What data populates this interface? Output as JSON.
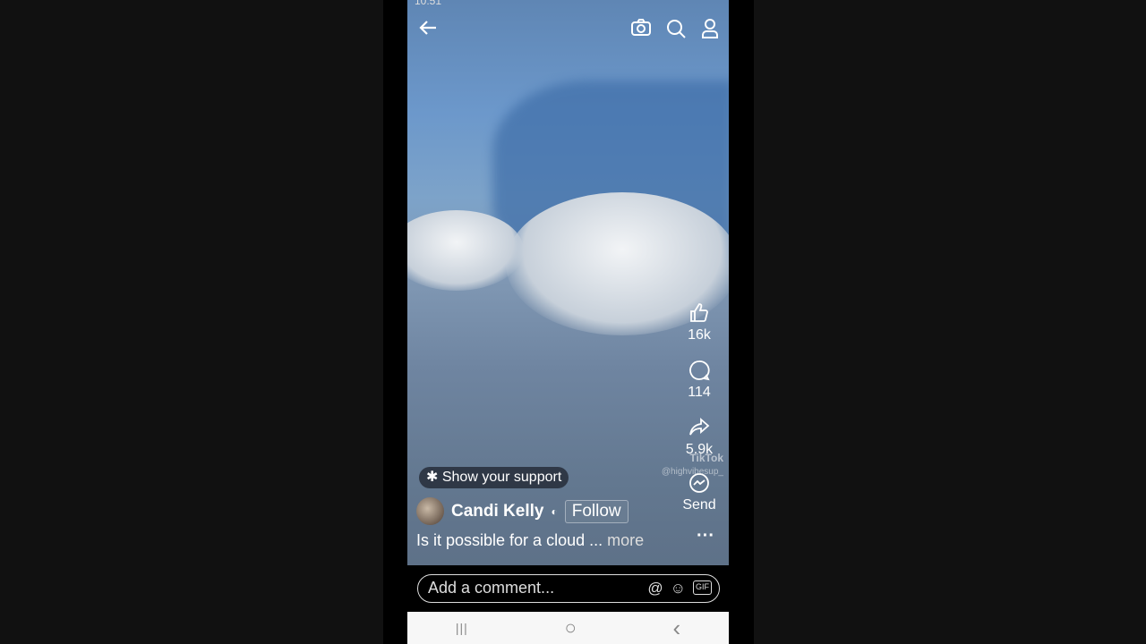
{
  "status_bar": {
    "time": "10:51"
  },
  "header": {
    "back_icon": "arrow-left-icon",
    "camera_icon": "camera-icon",
    "search_icon": "search-icon",
    "profile_icon": "person-icon"
  },
  "actions": {
    "likes": "16k",
    "comments": "114",
    "shares": "5.9k",
    "send_label": "Send"
  },
  "watermark": {
    "brand": "TikTok",
    "handle": "@highvibesup_"
  },
  "support_label": "Show your support",
  "author": {
    "name": "Candi Kelly",
    "follow_label": "Follow"
  },
  "caption": {
    "text": "Is it possible for a cloud ...",
    "more": "more"
  },
  "comment": {
    "placeholder": "Add a comment...",
    "mention": "@",
    "emoji": "☺",
    "gif": "GIF"
  },
  "navbar": {
    "recents": "|||",
    "home": "○",
    "back": "‹"
  }
}
